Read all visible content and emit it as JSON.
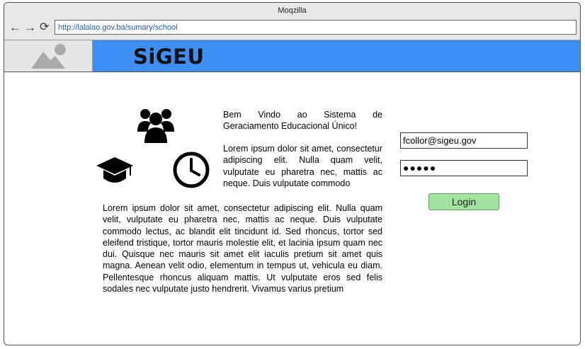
{
  "browser": {
    "title": "Moqzilla",
    "url": "http://lalalao.gov.ba/sumary/school",
    "back_icon": "←",
    "forward_icon": "→",
    "reload_icon": "⟳"
  },
  "app": {
    "brand": "SiGEU",
    "logo_icon": "image-placeholder-icon",
    "brand_color": "#3d8ff5"
  },
  "content": {
    "icons": [
      "users-icon",
      "graduation-cap-icon",
      "clock-icon"
    ],
    "welcome": "Bem Vindo ao Sistema de Geraciamento Educacional Único!",
    "paragraph1": "Lorem ipsum dolor sit amet, consectetur adipiscing elit. Nulla quam velit, vulputate eu pharetra nec, mattis ac neque. Duis vulputate commodo",
    "paragraph2": "Lorem ipsum dolor sit amet, consectetur adipiscing elit. Nulla quam velit, vulputate eu pharetra nec, mattis ac neque. Duis vulputate commodo lectus, ac blandit elit tincidunt id. Sed rhoncus, tortor sed eleifend tristique, tortor mauris molestie elit, et lacinia ipsum quam nec dui. Quisque nec mauris sit amet elit iaculis pretium sit amet quis magna. Aenean velit odio, elementum in tempus ut, vehicula eu diam. Pellentesque rhoncus aliquam mattis. Ut vulputate eros sed felis sodales nec vulputate justo hendrerit. Vivamus varius pretium"
  },
  "login": {
    "email_value": "fcollor@sigeu.gov",
    "password_value": "●●●●●",
    "button_label": "Login",
    "button_color": "#a3e3a0"
  }
}
